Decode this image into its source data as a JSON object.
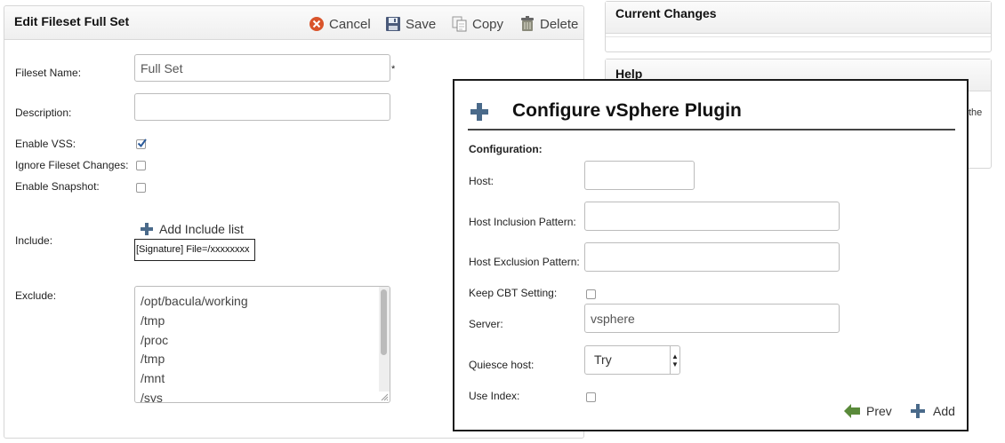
{
  "edit_panel": {
    "title": "Edit Fileset Full Set",
    "toolbar": {
      "cancel_label": "Cancel",
      "save_label": "Save",
      "copy_label": "Copy",
      "delete_label": "Delete"
    },
    "fields": {
      "fileset_name_label": "Fileset Name:",
      "fileset_name_value": "Full Set",
      "required_marker": "*",
      "description_label": "Description:",
      "description_value": "",
      "enable_vss_label": "Enable VSS:",
      "enable_vss_checked": true,
      "ignore_changes_label": "Ignore Fileset Changes:",
      "ignore_changes_checked": false,
      "enable_snapshot_label": "Enable Snapshot:",
      "enable_snapshot_checked": false,
      "include_label": "Include:",
      "add_include_label": "Add Include list",
      "include_entry": "[Signature] File=/xxxxxxxx",
      "exclude_label": "Exclude:",
      "exclude_items": [
        "/opt/bacula/working",
        "/tmp",
        "/proc",
        "/tmp",
        "/mnt",
        "/sys"
      ]
    }
  },
  "side_panels": {
    "current_changes_title": "Current Changes",
    "help_title": "Help",
    "help_text_fragment": "the"
  },
  "dialog": {
    "title": "Configure vSphere Plugin",
    "section_label": "Configuration:",
    "host_label": "Host:",
    "host_value": "",
    "host_inclusion_label": "Host Inclusion Pattern:",
    "host_inclusion_value": "",
    "host_exclusion_label": "Host Exclusion Pattern:",
    "host_exclusion_value": "",
    "keep_cbt_label": "Keep CBT Setting:",
    "keep_cbt_checked": false,
    "server_label": "Server:",
    "server_value": "vsphere",
    "quiesce_label": "Quiesce host:",
    "quiesce_value": "Try",
    "use_index_label": "Use Index:",
    "use_index_checked": false,
    "prev_label": "Prev",
    "add_label": "Add"
  },
  "colors": {
    "cancel_icon": "#d9542b",
    "checkbox_check": "#2a5a9a",
    "plus_icon": "#4a6a8a",
    "arrow_icon": "#5a8a3a"
  }
}
